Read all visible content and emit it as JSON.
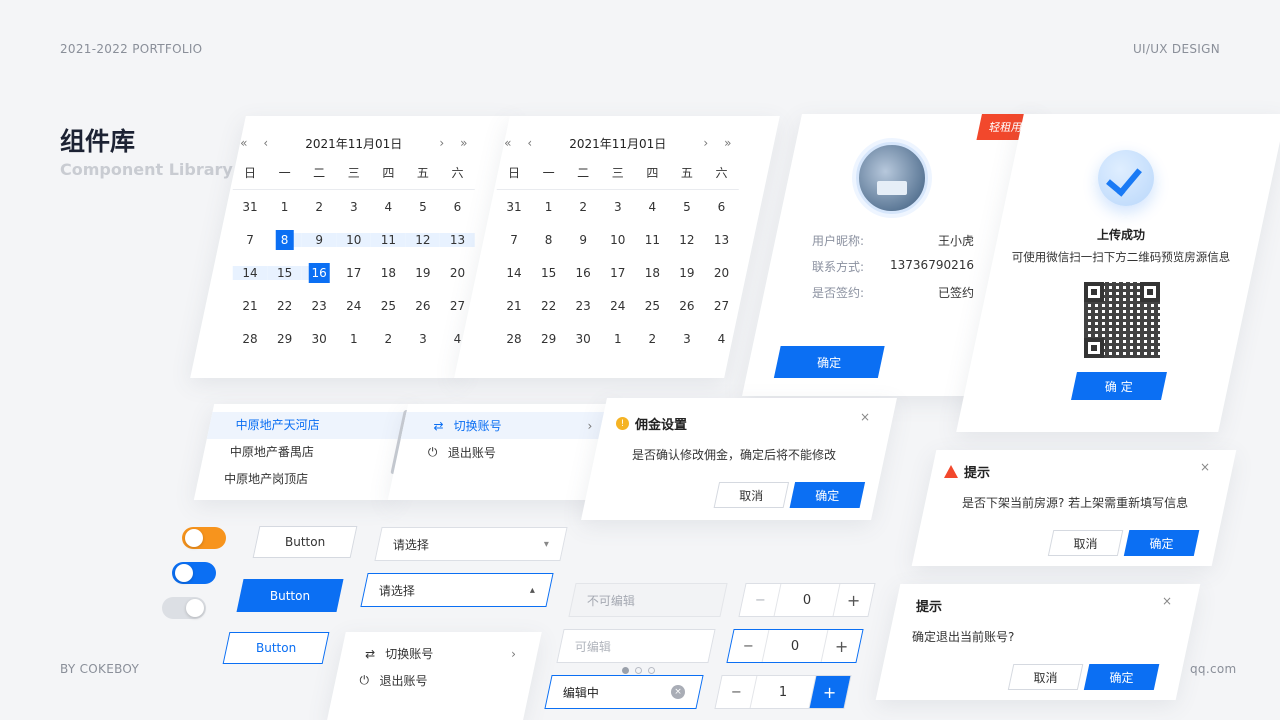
{
  "header": {
    "portfolio": "2021-2022 PORTFOLIO",
    "discipline": "UI/UX DESIGN"
  },
  "footer": {
    "author": "BY COKEBOY",
    "site": "qq.com"
  },
  "title": {
    "main": "组件库",
    "sub": "Component Library"
  },
  "calendars": [
    {
      "title": "2021年11月01日",
      "nav": {
        "prev_year": "«",
        "prev_month": "‹",
        "next_month": "›",
        "next_year": "»"
      },
      "weekdays": [
        "日",
        "一",
        "二",
        "三",
        "四",
        "五",
        "六"
      ],
      "weeks": [
        [
          "31",
          "1",
          "2",
          "3",
          "4",
          "5",
          "6"
        ],
        [
          "7",
          "8",
          "9",
          "10",
          "11",
          "12",
          "13"
        ],
        [
          "14",
          "15",
          "16",
          "17",
          "18",
          "19",
          "20"
        ],
        [
          "21",
          "22",
          "23",
          "24",
          "25",
          "26",
          "27"
        ],
        [
          "28",
          "29",
          "30",
          "1",
          "2",
          "3",
          "4"
        ]
      ]
    },
    {
      "title": "2021年11月01日",
      "nav": {
        "prev_year": "«",
        "prev_month": "‹",
        "next_month": "›",
        "next_year": "»"
      },
      "weekdays": [
        "日",
        "一",
        "二",
        "三",
        "四",
        "五",
        "六"
      ],
      "weeks": [
        [
          "31",
          "1",
          "2",
          "3",
          "4",
          "5",
          "6"
        ],
        [
          "7",
          "8",
          "9",
          "10",
          "11",
          "12",
          "13"
        ],
        [
          "14",
          "15",
          "16",
          "17",
          "18",
          "19",
          "20"
        ],
        [
          "21",
          "22",
          "23",
          "24",
          "25",
          "26",
          "27"
        ],
        [
          "28",
          "29",
          "30",
          "1",
          "2",
          "3",
          "4"
        ]
      ]
    }
  ],
  "user_card": {
    "badge": "轻租用户",
    "rows": [
      {
        "label": "用户昵称:",
        "value": "王小虎"
      },
      {
        "label": "联系方式:",
        "value": "13736790216"
      },
      {
        "label": "是否签约:",
        "value": "已签约"
      }
    ],
    "confirm": "确定"
  },
  "upload_card": {
    "title": "上传成功",
    "desc": "可使用微信扫一扫下方二维码预览房源信息",
    "confirm": "确 定"
  },
  "store_list": {
    "items": [
      "中原地产天河店",
      "中原地产番禺店",
      "中原地产岗顶店"
    ]
  },
  "account_menu": {
    "switch": "切换账号",
    "logout": "退出账号",
    "icons": {
      "switch": "⇄",
      "logout": "⏻",
      "chevron": "›"
    }
  },
  "commission_dialog": {
    "title": "佣金设置",
    "body": "是否确认修改佣金，确定后将不能修改",
    "cancel": "取消",
    "confirm": "确定",
    "close": "×"
  },
  "unlist_dialog": {
    "title": "提示",
    "body": "是否下架当前房源? 若上架需重新填写信息",
    "cancel": "取消",
    "confirm": "确定",
    "close": "×"
  },
  "logout_dialog": {
    "title": "提示",
    "body": "确定退出当前账号?",
    "cancel": "取消",
    "confirm": "确定",
    "close": "×"
  },
  "buttons": {
    "ghost": "Button",
    "primary": "Button",
    "outline": "Button"
  },
  "selects": [
    {
      "value": "请选择",
      "caret": "▾"
    },
    {
      "value": "请选择",
      "caret": "▴"
    }
  ],
  "inputs": {
    "disabled": "不可编辑",
    "editable": "可编辑",
    "editing": "编辑中",
    "clear": "×"
  },
  "steppers": [
    {
      "minus": "−",
      "value": "0",
      "plus": "+"
    },
    {
      "minus": "−",
      "value": "0",
      "plus": "+"
    },
    {
      "minus": "−",
      "value": "1",
      "plus": "+"
    }
  ],
  "colors": {
    "primary": "#0b6ff3",
    "orange": "#f7941d",
    "danger": "#f2482c",
    "warning": "#f5b324",
    "toggle_off": "#dcdfe4"
  }
}
